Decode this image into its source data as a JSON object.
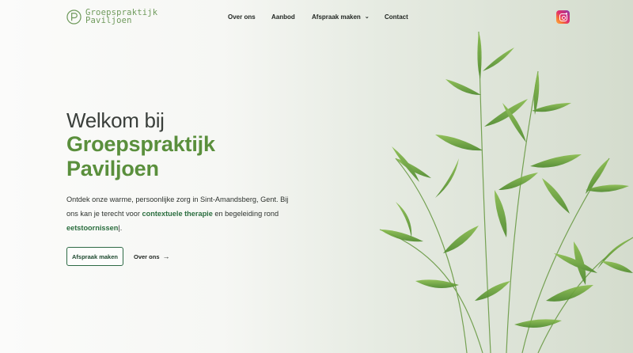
{
  "header": {
    "logo_line1": "Groepspraktijk",
    "logo_line2": "Paviljoen",
    "nav": [
      {
        "label": "Over ons"
      },
      {
        "label": "Aanbod"
      },
      {
        "label": "Afspraak maken",
        "has_dropdown": true
      },
      {
        "label": "Contact"
      }
    ],
    "social_icon": "instagram-icon"
  },
  "hero": {
    "welcome": "Welkom bij",
    "brand_line1": "Groepspraktijk",
    "brand_line2": "Paviljoen",
    "intro_part1": "Ontdek onze warme, persoonlijke zorg in Sint-Amandsberg, Gent. Bij ons kan je terecht voor ",
    "intro_link1": "contextuele therapie",
    "intro_part2": " en begeleiding rond ",
    "intro_link2": "eetstoornissen",
    "intro_part3": "|.",
    "primary_button": "Afspraak maken",
    "secondary_link": "Over ons",
    "secondary_arrow": "→"
  },
  "colors": {
    "brand_green": "#5a8f3c",
    "link_green": "#2b6e3f",
    "button_border": "#2e6a45"
  }
}
